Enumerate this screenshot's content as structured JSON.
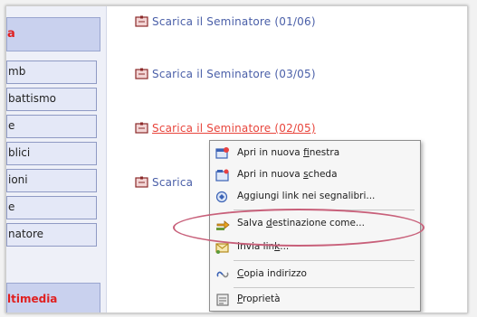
{
  "nav": {
    "top_label": "a",
    "items": [
      "mb",
      " battismo",
      "e",
      "blici",
      "ioni",
      "e",
      "natore"
    ],
    "bottom_label": "ltimedia"
  },
  "links": [
    {
      "text": "Scarica il Seminatore (01/06)"
    },
    {
      "text": "Scarica il Seminatore (03/05)"
    },
    {
      "text": "Scarica il Seminatore (02/05)"
    },
    {
      "text": "Scarica"
    }
  ],
  "context_menu": {
    "items": [
      {
        "pre": "Apri in nuova ",
        "acc": "f",
        "post": "inestra",
        "icon": "new-window-icon"
      },
      {
        "pre": "Apri in nuova ",
        "acc": "s",
        "post": "cheda",
        "icon": "new-tab-icon"
      },
      {
        "pre": "Aggiungi link nei segnalibri...",
        "acc": "",
        "post": "",
        "icon": "bookmark-icon"
      },
      {
        "pre": "Salva ",
        "acc": "d",
        "post": "estinazione come...",
        "icon": "save-target-icon"
      },
      {
        "pre": "Invia lin",
        "acc": "k",
        "post": "...",
        "icon": "send-link-icon"
      },
      {
        "pre": "",
        "acc": "C",
        "post": "opia indirizzo",
        "icon": "copy-link-icon"
      },
      {
        "pre": "",
        "acc": "P",
        "post": "roprietà",
        "icon": "properties-icon"
      }
    ]
  },
  "colors": {
    "link": "#4a5fa8",
    "link_hover": "#e8453c",
    "highlight_ellipse": "#c8607a",
    "nav_accent": "#e02020"
  }
}
